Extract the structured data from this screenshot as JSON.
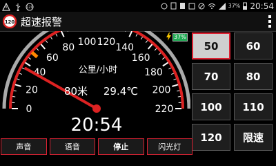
{
  "status": {
    "time": "20:54",
    "battery_pct": "37%",
    "icons": [
      "alert-icon",
      "usb-icon",
      "speed-icon",
      "sync-icon",
      "sd-icon",
      "notice-icon",
      "image-icon",
      "mute-icon",
      "wifi-icon",
      "signal-icon",
      "battery-icon"
    ]
  },
  "app": {
    "title": "超速报警",
    "icon": "speed-limit-120-icon",
    "icon_text": "120"
  },
  "gauge": {
    "ticks": [
      "0",
      "20",
      "40",
      "60",
      "80",
      "100",
      "120",
      "140",
      "160",
      "180",
      "200",
      "220"
    ],
    "unit": "公里/小时",
    "distance": "80米",
    "temperature": "29.4℃",
    "clock": "20:54",
    "speed_value": 36
  },
  "battery_indicator": {
    "pct": "37%",
    "icon": "lightning-icon"
  },
  "speed_buttons": [
    "50",
    "60",
    "70",
    "80",
    "100",
    "110",
    "120",
    "限速"
  ],
  "bottom_buttons": [
    "声音",
    "语音",
    "停止",
    "闪光灯"
  ],
  "colors": {
    "accent": "#dd2222",
    "active_bg": "#cfcfcf"
  }
}
